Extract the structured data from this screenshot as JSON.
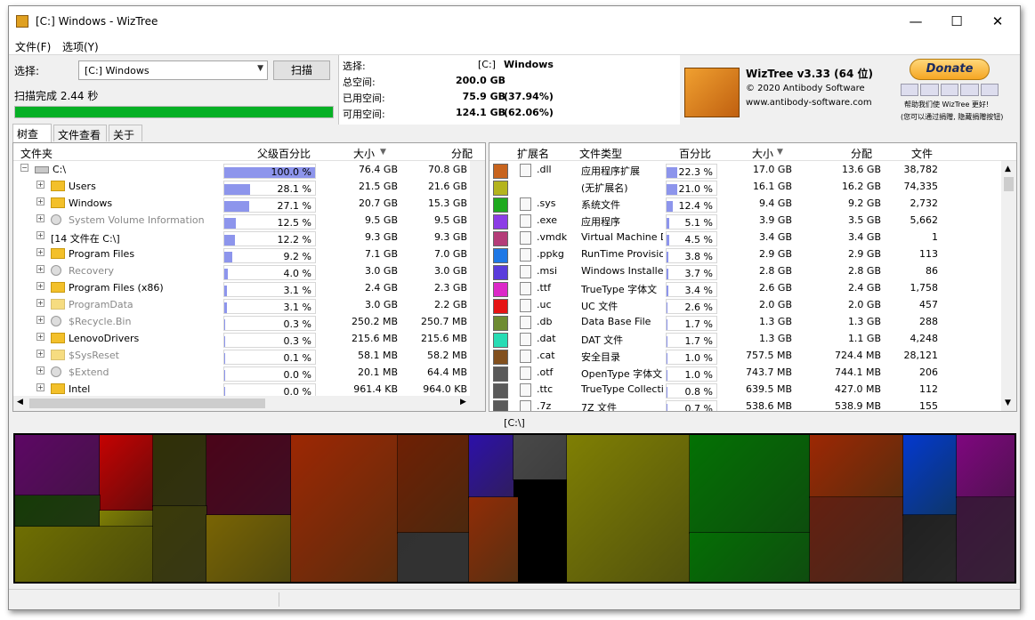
{
  "window": {
    "title": "[C:] Windows  - WizTree"
  },
  "menu": {
    "file": "文件(F)",
    "options": "选项(Y)"
  },
  "scan": {
    "select_label": "选择:",
    "drive_value": "[C:] Windows",
    "scan_button": "扫描",
    "status": "扫描完成 2.44 秒",
    "progress": 1.0
  },
  "stats": {
    "select_label": "选择:",
    "drive": "[C:]",
    "drive_name": "Windows",
    "total_label": "总空间:",
    "total_value": "200.0 GB",
    "used_label": "已用空间:",
    "used_value": "75.9 GB",
    "used_pct": "(37.94%)",
    "free_label": "可用空间:",
    "free_value": "124.1 GB",
    "free_pct": "(62.06%)"
  },
  "brand": {
    "name": "WizTree v3.33 (64 位)",
    "copyright": "© 2020 Antibody Software",
    "website": "www.antibody-software.com",
    "donate": "Donate",
    "help_line1": "帮助我们使 WizTree 更好!",
    "help_line2": "(您可以通过捐赠, 隐藏捐赠按钮)"
  },
  "tabs": [
    "树查看",
    "文件查看",
    "关于"
  ],
  "tree": {
    "headers": {
      "folder": "文件夹",
      "parent_pct": "父级百分比",
      "size": "大小",
      "alloc": "分配"
    },
    "rows": [
      {
        "name": "C:\\",
        "pct": 100.0,
        "pct_label": "100.0 %",
        "size": "76.4 GB",
        "alloc": "70.8 GB",
        "icon": "drive-icon",
        "kind": "drive"
      },
      {
        "name": "Users",
        "pct": 28.1,
        "pct_label": "28.1 %",
        "size": "21.5 GB",
        "alloc": "21.6 GB",
        "icon": "folder-icon",
        "kind": "folder"
      },
      {
        "name": "Windows",
        "pct": 27.1,
        "pct_label": "27.1 %",
        "size": "20.7 GB",
        "alloc": "15.3 GB",
        "icon": "folder-icon",
        "kind": "folder"
      },
      {
        "name": "System Volume Information",
        "pct": 12.5,
        "pct_label": "12.5 %",
        "size": "9.5 GB",
        "alloc": "9.5 GB",
        "icon": "system-folder-icon",
        "kind": "sys"
      },
      {
        "name": "[14 文件在 C:\\]",
        "pct": 12.2,
        "pct_label": "12.2 %",
        "size": "9.3 GB",
        "alloc": "9.3 GB",
        "icon": "",
        "kind": "files"
      },
      {
        "name": "Program Files",
        "pct": 9.2,
        "pct_label": "9.2 %",
        "size": "7.1 GB",
        "alloc": "7.0 GB",
        "icon": "folder-icon",
        "kind": "folder"
      },
      {
        "name": "Recovery",
        "pct": 4.0,
        "pct_label": "4.0 %",
        "size": "3.0 GB",
        "alloc": "3.0 GB",
        "icon": "system-folder-icon",
        "kind": "sys"
      },
      {
        "name": "Program Files (x86)",
        "pct": 3.1,
        "pct_label": "3.1 %",
        "size": "2.4 GB",
        "alloc": "2.3 GB",
        "icon": "folder-icon",
        "kind": "folder"
      },
      {
        "name": "ProgramData",
        "pct": 3.1,
        "pct_label": "3.1 %",
        "size": "3.0 GB",
        "alloc": "2.2 GB",
        "icon": "folder-icon",
        "kind": "pale"
      },
      {
        "name": "$Recycle.Bin",
        "pct": 0.3,
        "pct_label": "0.3 %",
        "size": "250.2 MB",
        "alloc": "250.7 MB",
        "icon": "system-folder-icon",
        "kind": "sys"
      },
      {
        "name": "LenovoDrivers",
        "pct": 0.3,
        "pct_label": "0.3 %",
        "size": "215.6 MB",
        "alloc": "215.6 MB",
        "icon": "folder-icon",
        "kind": "folder"
      },
      {
        "name": "$SysReset",
        "pct": 0.1,
        "pct_label": "0.1 %",
        "size": "58.1 MB",
        "alloc": "58.2 MB",
        "icon": "folder-icon",
        "kind": "pale"
      },
      {
        "name": "$Extend",
        "pct": 0.0,
        "pct_label": "0.0 %",
        "size": "20.1 MB",
        "alloc": "64.4 MB",
        "icon": "system-folder-icon",
        "kind": "sys"
      },
      {
        "name": "Intel",
        "pct": 0.0,
        "pct_label": "0.0 %",
        "size": "961.4 KB",
        "alloc": "964.0 KB",
        "icon": "folder-icon",
        "kind": "folder"
      }
    ]
  },
  "ext": {
    "headers": {
      "ext": "扩展名",
      "type": "文件类型",
      "pct": "百分比",
      "size": "大小",
      "alloc": "分配",
      "files": "文件"
    },
    "rows": [
      {
        "color": "#c8641e",
        "ext": ".dll",
        "type": "应用程序扩展",
        "pct": 22.3,
        "pct_label": "22.3 %",
        "size": "17.0 GB",
        "alloc": "13.6 GB",
        "files": "38,782"
      },
      {
        "color": "#b4b41e",
        "ext": "",
        "type": "(无扩展名)",
        "pct": 21.0,
        "pct_label": "21.0 %",
        "size": "16.1 GB",
        "alloc": "16.2 GB",
        "files": "74,335"
      },
      {
        "color": "#1eaa1e",
        "ext": ".sys",
        "type": "系统文件",
        "pct": 12.4,
        "pct_label": "12.4 %",
        "size": "9.4 GB",
        "alloc": "9.2 GB",
        "files": "2,732"
      },
      {
        "color": "#8c3ce6",
        "ext": ".exe",
        "type": "应用程序",
        "pct": 5.1,
        "pct_label": "5.1 %",
        "size": "3.9 GB",
        "alloc": "3.5 GB",
        "files": "5,662"
      },
      {
        "color": "#b43c78",
        "ext": ".vmdk",
        "type": "Virtual Machine Dis",
        "pct": 4.5,
        "pct_label": "4.5 %",
        "size": "3.4 GB",
        "alloc": "3.4 GB",
        "files": "1"
      },
      {
        "color": "#1e78e6",
        "ext": ".ppkg",
        "type": "RunTime Provisioni",
        "pct": 3.8,
        "pct_label": "3.8 %",
        "size": "2.9 GB",
        "alloc": "2.9 GB",
        "files": "113"
      },
      {
        "color": "#5a3cdc",
        "ext": ".msi",
        "type": "Windows Installer",
        "pct": 3.7,
        "pct_label": "3.7 %",
        "size": "2.8 GB",
        "alloc": "2.8 GB",
        "files": "86"
      },
      {
        "color": "#dc28c8",
        "ext": ".ttf",
        "type": "TrueType 字体文",
        "pct": 3.4,
        "pct_label": "3.4 %",
        "size": "2.6 GB",
        "alloc": "2.4 GB",
        "files": "1,758"
      },
      {
        "color": "#e61414",
        "ext": ".uc",
        "type": "UC 文件",
        "pct": 2.6,
        "pct_label": "2.6 %",
        "size": "2.0 GB",
        "alloc": "2.0 GB",
        "files": "457"
      },
      {
        "color": "#6e8c32",
        "ext": ".db",
        "type": "Data Base File",
        "pct": 1.7,
        "pct_label": "1.7 %",
        "size": "1.3 GB",
        "alloc": "1.3 GB",
        "files": "288"
      },
      {
        "color": "#28dcb4",
        "ext": ".dat",
        "type": "DAT 文件",
        "pct": 1.7,
        "pct_label": "1.7 %",
        "size": "1.3 GB",
        "alloc": "1.1 GB",
        "files": "4,248"
      },
      {
        "color": "#82501e",
        "ext": ".cat",
        "type": "安全目录",
        "pct": 1.0,
        "pct_label": "1.0 %",
        "size": "757.5 MB",
        "alloc": "724.4 MB",
        "files": "28,121"
      },
      {
        "color": "#5a5a5a",
        "ext": ".otf",
        "type": "OpenType 字体文",
        "pct": 1.0,
        "pct_label": "1.0 %",
        "size": "743.7 MB",
        "alloc": "744.1 MB",
        "files": "206"
      },
      {
        "color": "#5a5a5a",
        "ext": ".ttc",
        "type": "TrueType Collectio",
        "pct": 0.8,
        "pct_label": "0.8 %",
        "size": "639.5 MB",
        "alloc": "427.0 MB",
        "files": "112"
      },
      {
        "color": "#5a5a5a",
        "ext": ".7z",
        "type": "7Z 文件",
        "pct": 0.7,
        "pct_label": "0.7 %",
        "size": "538.6 MB",
        "alloc": "538.9 MB",
        "files": "155"
      }
    ]
  },
  "treemap": {
    "path": "[C:\\]"
  }
}
